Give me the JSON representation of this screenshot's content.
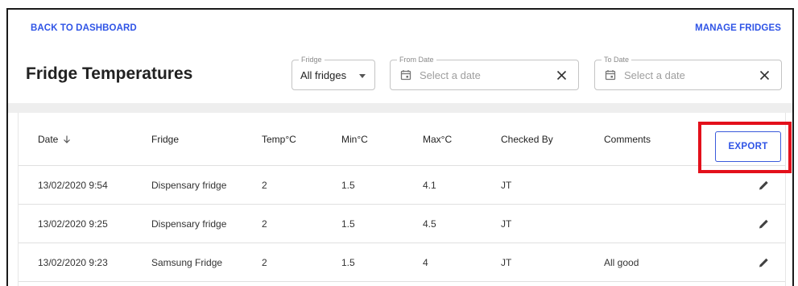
{
  "nav": {
    "back_label": "BACK TO DASHBOARD",
    "manage_label": "MANAGE FRIDGES"
  },
  "page": {
    "title": "Fridge Temperatures"
  },
  "filters": {
    "fridge": {
      "label": "Fridge",
      "value": "All fridges"
    },
    "from_date": {
      "label": "From Date",
      "placeholder": "Select a date"
    },
    "to_date": {
      "label": "To Date",
      "placeholder": "Select a date"
    }
  },
  "table": {
    "columns": [
      "Date",
      "Fridge",
      "Temp°C",
      "Min°C",
      "Max°C",
      "Checked By",
      "Comments"
    ],
    "export_label": "EXPORT",
    "rows": [
      [
        "13/02/2020 9:54",
        "Dispensary fridge",
        "2",
        "1.5",
        "4.1",
        "JT",
        ""
      ],
      [
        "13/02/2020 9:25",
        "Dispensary fridge",
        "2",
        "1.5",
        "4.5",
        "JT",
        ""
      ],
      [
        "13/02/2020 9:23",
        "Samsung Fridge",
        "2",
        "1.5",
        "4",
        "JT",
        "All good"
      ]
    ]
  },
  "colors": {
    "accent": "#2f54e6",
    "highlight": "#e3101b",
    "band": "#eeeeee"
  },
  "icons": {
    "sort": "arrow-down-icon",
    "dropdown": "caret-down-icon",
    "calendar": "calendar-icon",
    "clear": "close-icon",
    "edit": "pencil-icon"
  }
}
